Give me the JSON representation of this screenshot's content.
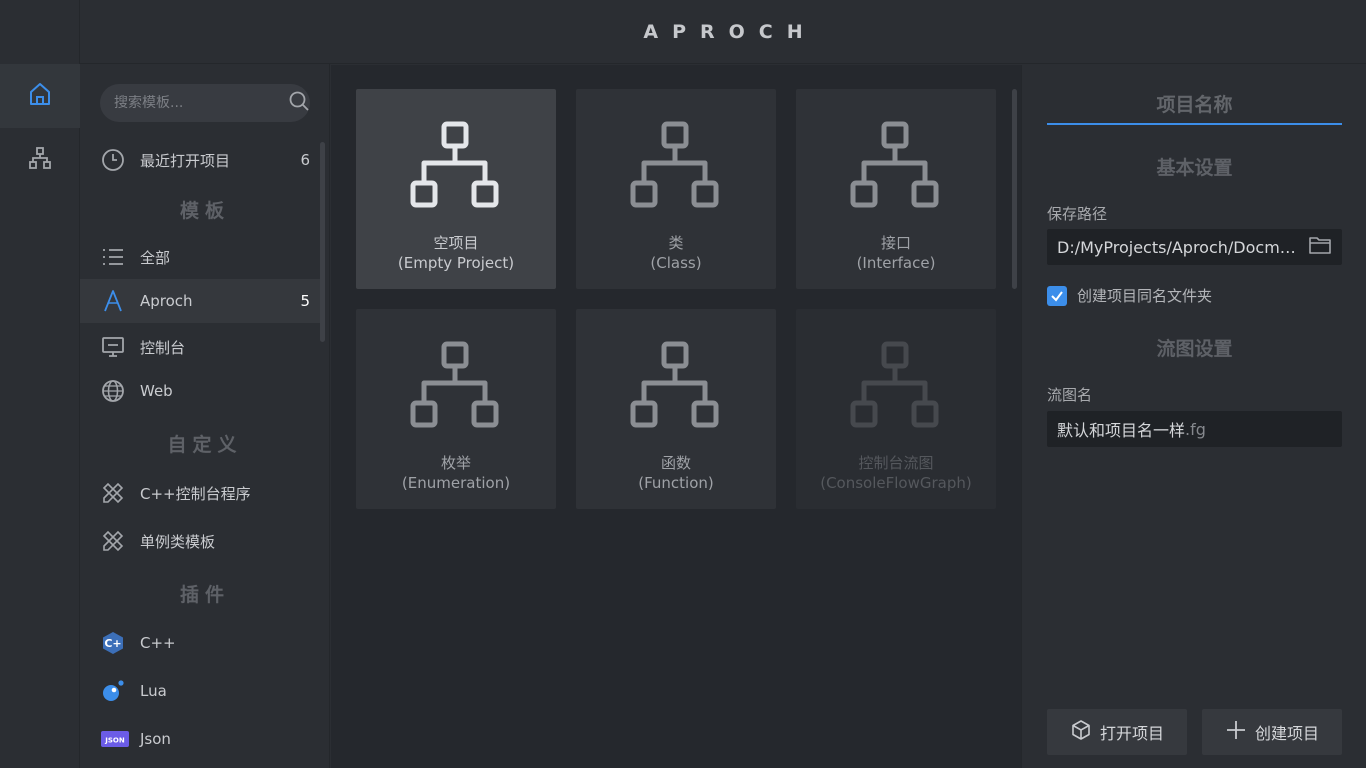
{
  "app": {
    "brand": "APROCH"
  },
  "rail": [
    {
      "icon": "home-icon",
      "active": true
    },
    {
      "icon": "hierarchy-icon",
      "active": false
    }
  ],
  "search": {
    "placeholder": "搜索模板..."
  },
  "sidebar": {
    "recent": {
      "label": "最近打开项目",
      "count": "6",
      "icon": "clock-icon"
    },
    "templates_title": "模板",
    "templates": [
      {
        "label": "全部",
        "icon": "list-icon",
        "count": ""
      },
      {
        "label": "Aproch",
        "icon": "aproch-logo-icon",
        "count": "5"
      },
      {
        "label": "控制台",
        "icon": "monitor-icon",
        "count": ""
      },
      {
        "label": "Web",
        "icon": "globe-icon",
        "count": ""
      }
    ],
    "custom_title": "自定义",
    "custom": [
      {
        "label": "C++控制台程序",
        "icon": "design-tools-icon"
      },
      {
        "label": "单例类模板",
        "icon": "design-tools-icon"
      }
    ],
    "plugins_title": "插件",
    "plugins": [
      {
        "label": "C++",
        "icon": "cpp-icon"
      },
      {
        "label": "Lua",
        "icon": "lua-icon"
      },
      {
        "label": "Json",
        "icon": "json-icon",
        "badge": "JSON"
      }
    ]
  },
  "cards": [
    {
      "title": "空项目",
      "subtitle": "(Empty Project)",
      "state": "selected"
    },
    {
      "title": "类",
      "subtitle": "(Class)",
      "state": "normal"
    },
    {
      "title": "接口",
      "subtitle": "(Interface)",
      "state": "normal"
    },
    {
      "title": "枚举",
      "subtitle": "(Enumeration)",
      "state": "normal"
    },
    {
      "title": "函数",
      "subtitle": "(Function)",
      "state": "normal"
    },
    {
      "title": "控制台流图",
      "subtitle": "(ConsoleFlowGraph)",
      "state": "disabled"
    }
  ],
  "panel": {
    "project_name_placeholder": "项目名称",
    "basic_title": "基本设置",
    "save_path_label": "保存路径",
    "save_path_value": "D:/MyProjects/Aproch/Docments",
    "create_folder_label": "创建项目同名文件夹",
    "create_folder_checked": true,
    "flow_title": "流图设置",
    "flow_name_label": "流图名",
    "flow_name_value": "默认和项目名一样",
    "flow_name_ext": ".fg",
    "open_button": "打开项目",
    "create_button": "创建项目"
  },
  "colors": {
    "accent": "#3c8eea",
    "background": "#2b2e33",
    "main": "#25282d"
  }
}
